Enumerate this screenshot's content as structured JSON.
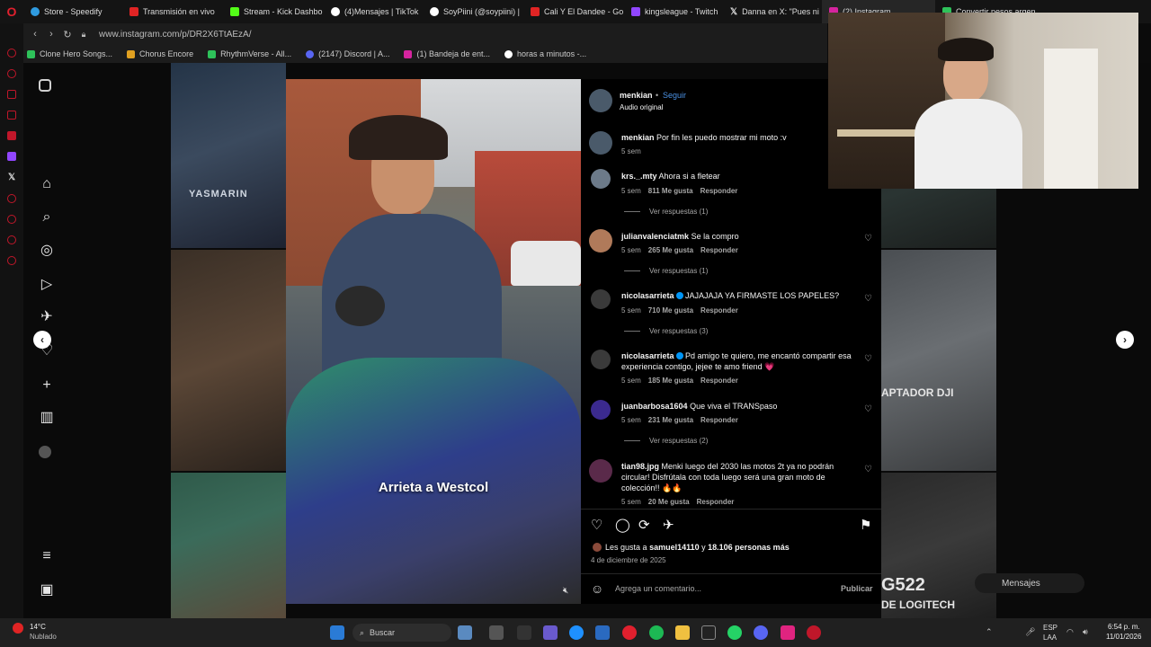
{
  "browser": {
    "tabs": [
      {
        "label": "Store - Speedify",
        "color": "#2f9be0"
      },
      {
        "label": "Transmisión en vivo",
        "color": "#e02424"
      },
      {
        "label": "Stream - Kick Dashbo",
        "color": "#53fc18"
      },
      {
        "label": "(4)Mensajes | TikTok",
        "color": "#ffffff"
      },
      {
        "label": "SoyPiini (@soypiini) |",
        "color": "#ffffff"
      },
      {
        "label": "Cali Y El Dandee - Go",
        "color": "#e02424"
      },
      {
        "label": "kingsleague - Twitch",
        "color": "#9146ff"
      },
      {
        "label": "Danna en X: \"Pues ni",
        "color": "#ffffff"
      },
      {
        "label": "(2) Instagram",
        "color": "#d6249f",
        "active": true
      },
      {
        "label": "Convertir pesos argen",
        "color": "#2ec25a"
      }
    ],
    "url": "www.instagram.com/p/DR2X6TtAEzA/",
    "bookmarks": [
      {
        "label": "Clone Hero Songs...",
        "color": "#2ec25a"
      },
      {
        "label": "Chorus Encore",
        "color": "#e0a020"
      },
      {
        "label": "RhythmVerse - All...",
        "color": "#2ec25a"
      },
      {
        "label": "(2147) Discord | A...",
        "color": "#5865f2"
      },
      {
        "label": "(1) Bandeja de ent...",
        "color": "#d6249f"
      },
      {
        "label": "horas a minutos -...",
        "color": "#ffffff"
      }
    ]
  },
  "post": {
    "author": "menkian",
    "follow_label": "Seguir",
    "audio": "Audio original",
    "video_caption": "Arrieta a Westcol",
    "caption_author": "menkian",
    "caption_text": "Por fin les puedo mostrar mi moto :v",
    "caption_time": "5 sem",
    "likes_prefix": "Les gusta a",
    "likes_user": "samuel14110",
    "likes_mid": "y",
    "likes_count": "18.106 personas más",
    "date": "4 de diciembre de 2025",
    "comment_placeholder": "Agrega un comentario...",
    "publish_label": "Publicar"
  },
  "comments": [
    {
      "user": "krs._.mty",
      "text": "Ahora si a fletear",
      "time": "5 sem",
      "likes": "811 Me gusta",
      "reply": "Responder",
      "replies": "Ver respuestas (1)",
      "avatar_color": "#6c7a89"
    },
    {
      "user": "julianvalenciatmk",
      "text": "Se la compro",
      "time": "5 sem",
      "likes": "265 Me gusta",
      "reply": "Responder",
      "replies": "Ver respuestas (1)",
      "avatar_color": "#b07a5a"
    },
    {
      "user": "nicolasarrieta",
      "text": "JAJAJAJA YA FIRMASTE LOS PAPELES?",
      "time": "5 sem",
      "likes": "710 Me gusta",
      "reply": "Responder",
      "replies": "Ver respuestas (3)",
      "avatar_color": "#3a3a3a",
      "verified": true
    },
    {
      "user": "nicolasarrieta",
      "text": "Pd amigo te quiero, me encantó compartir esa",
      "text2": "experiencia contigo, jejee te amo friend 💗",
      "time": "5 sem",
      "likes": "185 Me gusta",
      "reply": "Responder",
      "avatar_color": "#3a3a3a",
      "verified": true
    },
    {
      "user": "juanbarbosa1604",
      "text": "Que viva el TRANSpaso",
      "time": "5 sem",
      "likes": "231 Me gusta",
      "reply": "Responder",
      "replies": "Ver respuestas (2)",
      "avatar_color": "#3b2a8f"
    },
    {
      "user": "tian98.jpg",
      "text": "Menki luego del 2030 las motos 2t ya no podrán",
      "text2": "circular! Disfrútala con toda luego será una gran moto de",
      "text3": "colección!! 🔥🔥",
      "time": "5 sem",
      "likes": "20 Me gusta",
      "reply": "Responder",
      "avatar_color": "#5a2a4a"
    }
  ],
  "background_tiles": {
    "right_label_1": "APTADOR DJI",
    "right_label_2": "G522",
    "right_label_3": "DE LOGITECH",
    "left_label": "YASMARIN",
    "messages_label": "Mensajes"
  },
  "taskbar": {
    "weather_temp": "14°C",
    "weather_desc": "Nublado",
    "search_label": "Buscar",
    "lang_top": "ESP",
    "lang_bottom": "LAA",
    "time": "6:54 p. m.",
    "date": "11/01/2026"
  }
}
